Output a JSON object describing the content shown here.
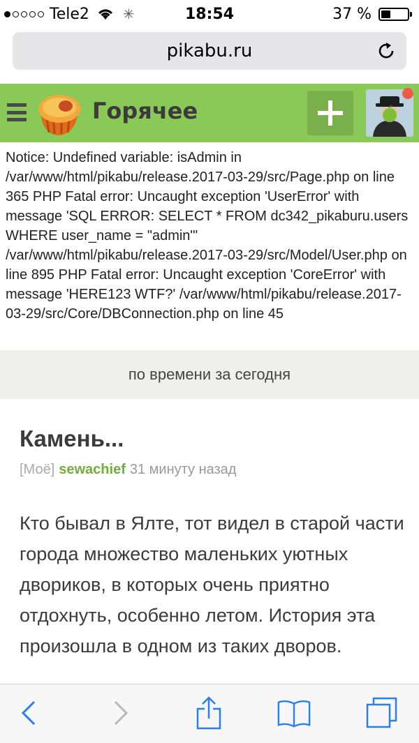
{
  "status_bar": {
    "signal_bars": 1,
    "carrier": "Tele2",
    "time": "18:54",
    "battery_percent": "37 %",
    "battery_level": 0.37
  },
  "browser": {
    "url": "pikabu.ru"
  },
  "header": {
    "title": "Горячее",
    "colors": {
      "bar": "#8ac858",
      "add_button": "#79b04c",
      "notification": "#f05a4a"
    }
  },
  "error_message": "Notice: Undefined variable: isAdmin in /var/www/html/pikabu/release.2017-03-29/src/Page.php on line 365 PHP Fatal error: Uncaught exception 'UserError' with message 'SQL ERROR: SELECT * FROM dc342_pikaburu.users WHERE user_name = \"admin\"' /var/www/html/pikabu/release.2017-03-29/src/Model/User.php on line 895 PHP Fatal error: Uncaught exception 'CoreError' with message 'HERE123 WTF?' /var/www/html/pikabu/release.2017-03-29/src/Core/DBConnection.php on line 45",
  "filter": {
    "label": "по времени за сегодня"
  },
  "post": {
    "title": "Камень...",
    "tag": "[Моё]",
    "author": "sewachief",
    "time": "31 минуту назад",
    "body": "Кто бывал в Ялте, тот видел в старой части города множество маленьких уютных двориков, в которых очень приятно отдохнуть, особенно летом. История эта произошла в одном из таких дворов."
  },
  "toolbar": {
    "icons": [
      "back-icon",
      "forward-icon",
      "share-icon",
      "bookmarks-icon",
      "tabs-icon"
    ]
  }
}
